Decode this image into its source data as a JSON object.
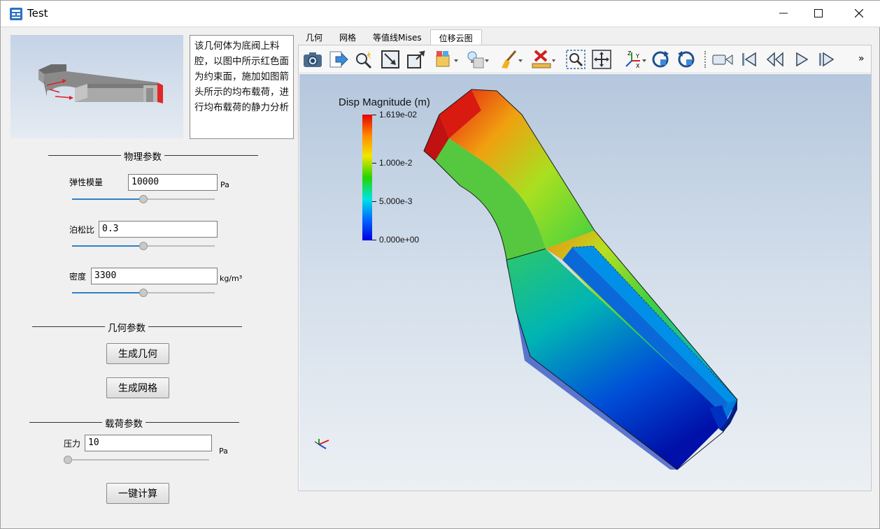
{
  "window": {
    "title": "Test"
  },
  "description": "该几何体为底阀上料腔，以图中所示红色面为约束面，施加如图箭头所示的均布载荷，进行均布载荷的静力分析",
  "groups": {
    "physical": "物理参数",
    "geometry": "几何参数",
    "load": "载荷参数"
  },
  "fields": {
    "elastic_modulus": {
      "label": "弹性模量",
      "value": "10000",
      "unit": "Pa",
      "slider": 0.5
    },
    "poisson": {
      "label": "泊松比",
      "value": "0.3",
      "unit": "",
      "slider": 0.5
    },
    "density": {
      "label": "密度",
      "value": "3300",
      "unit": "kg/m³",
      "slider": 0.5
    },
    "pressure": {
      "label": "压力",
      "value": "10",
      "unit": "Pa",
      "slider": 0.0
    }
  },
  "buttons": {
    "gen_geometry": "生成几何",
    "gen_mesh": "生成网格",
    "compute": "一键计算"
  },
  "tabs": [
    {
      "label": "几何"
    },
    {
      "label": "网格"
    },
    {
      "label": "等值线Mises"
    },
    {
      "label": "位移云图",
      "active": true
    }
  ],
  "toolbar": {
    "icons": [
      "camera-icon",
      "export-icon",
      "magic-zoom-icon",
      "reset-view-icon",
      "fit-view-icon",
      "selection-icon",
      "light-icon",
      "clear-icon",
      "delete-icon",
      "zoom-box-icon",
      "move-icon",
      "axes-icon",
      "rotate-cw-icon",
      "rotate-ccw-icon",
      "camera-record-icon",
      "first-frame-icon",
      "prev-frame-icon",
      "play-icon",
      "last-frame-icon"
    ],
    "overflow": "»"
  },
  "colorbar": {
    "title": "Disp Magnitude (m)",
    "labels": [
      "1.619e-02",
      "1.000e-2",
      "5.000e-3",
      "0.000e+00"
    ],
    "max": 0.01619,
    "min": 0.0
  }
}
